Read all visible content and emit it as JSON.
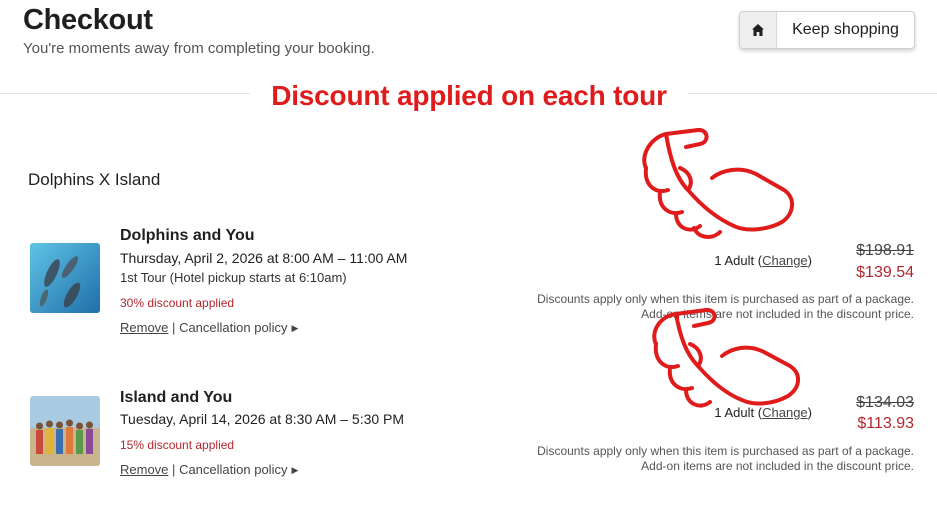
{
  "header": {
    "title": "Checkout",
    "subtitle": "You're moments away from completing your booking.",
    "keep_shopping_label": "Keep shopping"
  },
  "annotation": {
    "banner": "Discount applied on each tour",
    "color": "#e01b1b"
  },
  "package": {
    "name": "Dolphins X Island"
  },
  "tours": [
    {
      "title": "Dolphins and You",
      "date": "Thursday, April 2, 2026 at 8:00 AM – 11:00 AM",
      "note": "1st Tour (Hotel pickup starts at 6:10am)",
      "discount": "30% discount applied",
      "remove_label": "Remove",
      "separator": "|",
      "policy_label": "Cancellation policy",
      "quantity": "1 Adult",
      "change_label": "Change",
      "original_price": "$198.91",
      "discounted_price": "$139.54",
      "disclaimer_line1": "Discounts apply only when this item is purchased as part of a package.",
      "disclaimer_line2": "Add-on items are not included in the discount price."
    },
    {
      "title": "Island and You",
      "date": "Tuesday, April 14, 2026 at 8:30 AM – 5:30 PM",
      "discount": "15% discount applied",
      "remove_label": "Remove",
      "separator": "|",
      "policy_label": "Cancellation policy",
      "quantity": "1 Adult",
      "change_label": "Change",
      "original_price": "$134.03",
      "discounted_price": "$113.93",
      "disclaimer_line1": "Discounts apply only when this item is purchased as part of a package.",
      "disclaimer_line2": "Add-on items are not included in the discount price."
    }
  ],
  "colors": {
    "discount_red": "#b3262d",
    "annotation_red": "#e01b1b"
  },
  "icons": {
    "keep_shopping": "home-icon",
    "policy": "caret-right-icon",
    "annotation": "pointing-hand-icon"
  }
}
